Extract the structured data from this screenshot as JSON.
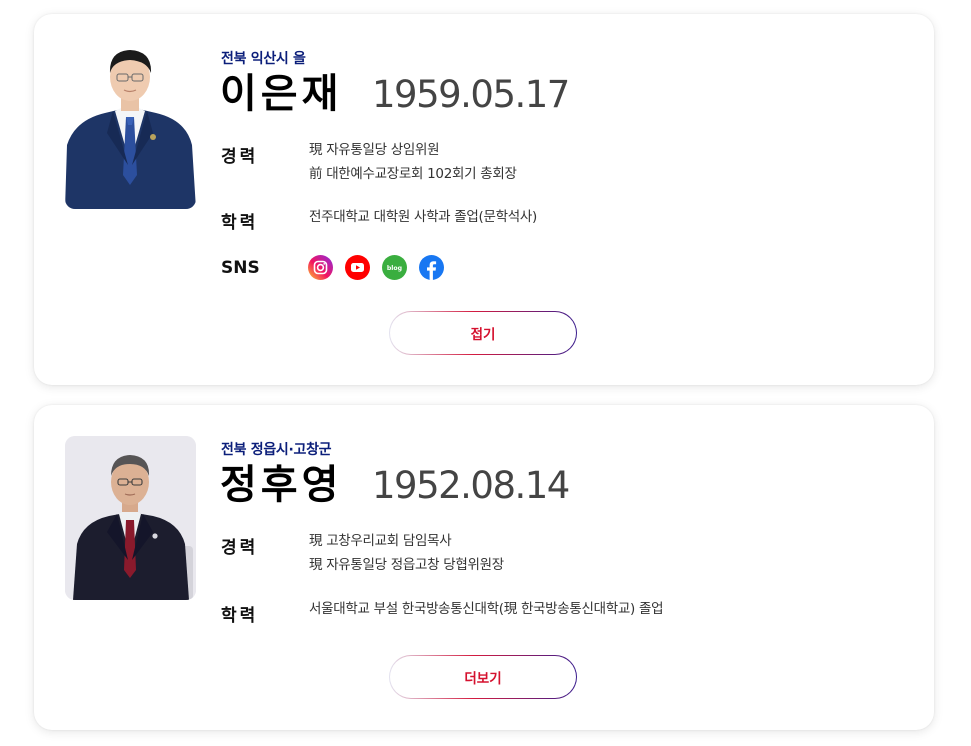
{
  "candidates": [
    {
      "region": "전북 익산시 을",
      "name": "이은재",
      "birth": "1959.05.17",
      "career_label": "경력",
      "career": [
        "現 자유통일당 상임위원",
        "前 대한예수교장로회 102회기 총회장"
      ],
      "education_label": "학력",
      "education": "전주대학교 대학원 사학과 졸업(문학석사)",
      "sns_label": "SNS",
      "sns": [
        {
          "icon": "instagram-icon",
          "color": "#d6249f"
        },
        {
          "icon": "youtube-icon",
          "color": "#ff0000"
        },
        {
          "icon": "blog-icon",
          "text": "blog",
          "color": "#2db400"
        },
        {
          "icon": "facebook-icon",
          "color": "#1877f2"
        }
      ],
      "toggle_label": "접기"
    },
    {
      "region": "전북 정읍시·고창군",
      "name": "정후영",
      "birth": "1952.08.14",
      "career_label": "경력",
      "career": [
        "現 고창우리교회 담임목사",
        "現 자유통일당 정읍고창 당협위원장"
      ],
      "education_label": "학력",
      "education": "서울대학교 부설 한국방송통신대학(現 한국방송통신대학교) 졸업",
      "toggle_label": "더보기"
    }
  ],
  "colors": {
    "region": "#0b1e7a",
    "button_text": "#d5112e"
  }
}
